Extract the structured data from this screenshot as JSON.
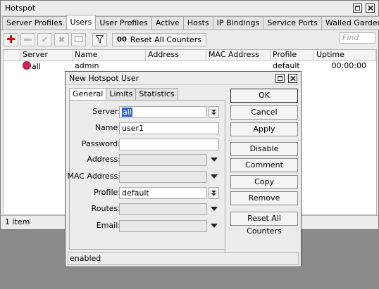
{
  "window": {
    "title": "Hotspot"
  },
  "tabs": [
    {
      "label": "Server Profiles"
    },
    {
      "label": "Users",
      "active": true
    },
    {
      "label": "User Profiles"
    },
    {
      "label": "Active"
    },
    {
      "label": "Hosts"
    },
    {
      "label": "IP Bindings"
    },
    {
      "label": "Service Ports"
    },
    {
      "label": "Walled Garden"
    }
  ],
  "toolbar": {
    "reset_counters_icon_text": "00",
    "reset_counters_label": "Reset All Counters",
    "find_placeholder": "Find"
  },
  "table": {
    "columns": [
      "",
      "Server",
      "Name",
      "Address",
      "MAC Address",
      "Profile",
      "Uptime"
    ],
    "rows": [
      {
        "server": "all",
        "name": "admin",
        "address": "",
        "mac": "",
        "profile": "default",
        "uptime": "00:00:00"
      }
    ]
  },
  "status": {
    "item_count": "1 item"
  },
  "dialog": {
    "title": "New Hotspot User",
    "tabs": [
      "General",
      "Limits",
      "Statistics"
    ],
    "fields": {
      "server": {
        "label": "Server:",
        "value": "all"
      },
      "name": {
        "label": "Name:",
        "value": "user1"
      },
      "password": {
        "label": "Password:",
        "value": ""
      },
      "address": {
        "label": "Address:",
        "value": ""
      },
      "mac": {
        "label": "MAC Address:",
        "value": ""
      },
      "profile": {
        "label": "Profile:",
        "value": "default"
      },
      "routes": {
        "label": "Routes:",
        "value": ""
      },
      "email": {
        "label": "Email:",
        "value": ""
      }
    },
    "buttons": {
      "ok": "OK",
      "cancel": "Cancel",
      "apply": "Apply",
      "disable": "Disable",
      "comment": "Comment",
      "copy": "Copy",
      "remove": "Remove",
      "reset": "Reset All Counters"
    },
    "status": "enabled"
  },
  "colors": {
    "selection": "#2a62c8",
    "add_icon": "#dd0000",
    "user_icon": "#d02060"
  },
  "icons": [
    "add-icon",
    "remove-icon",
    "enable-icon",
    "disable-icon",
    "comment-icon",
    "filter-icon"
  ]
}
